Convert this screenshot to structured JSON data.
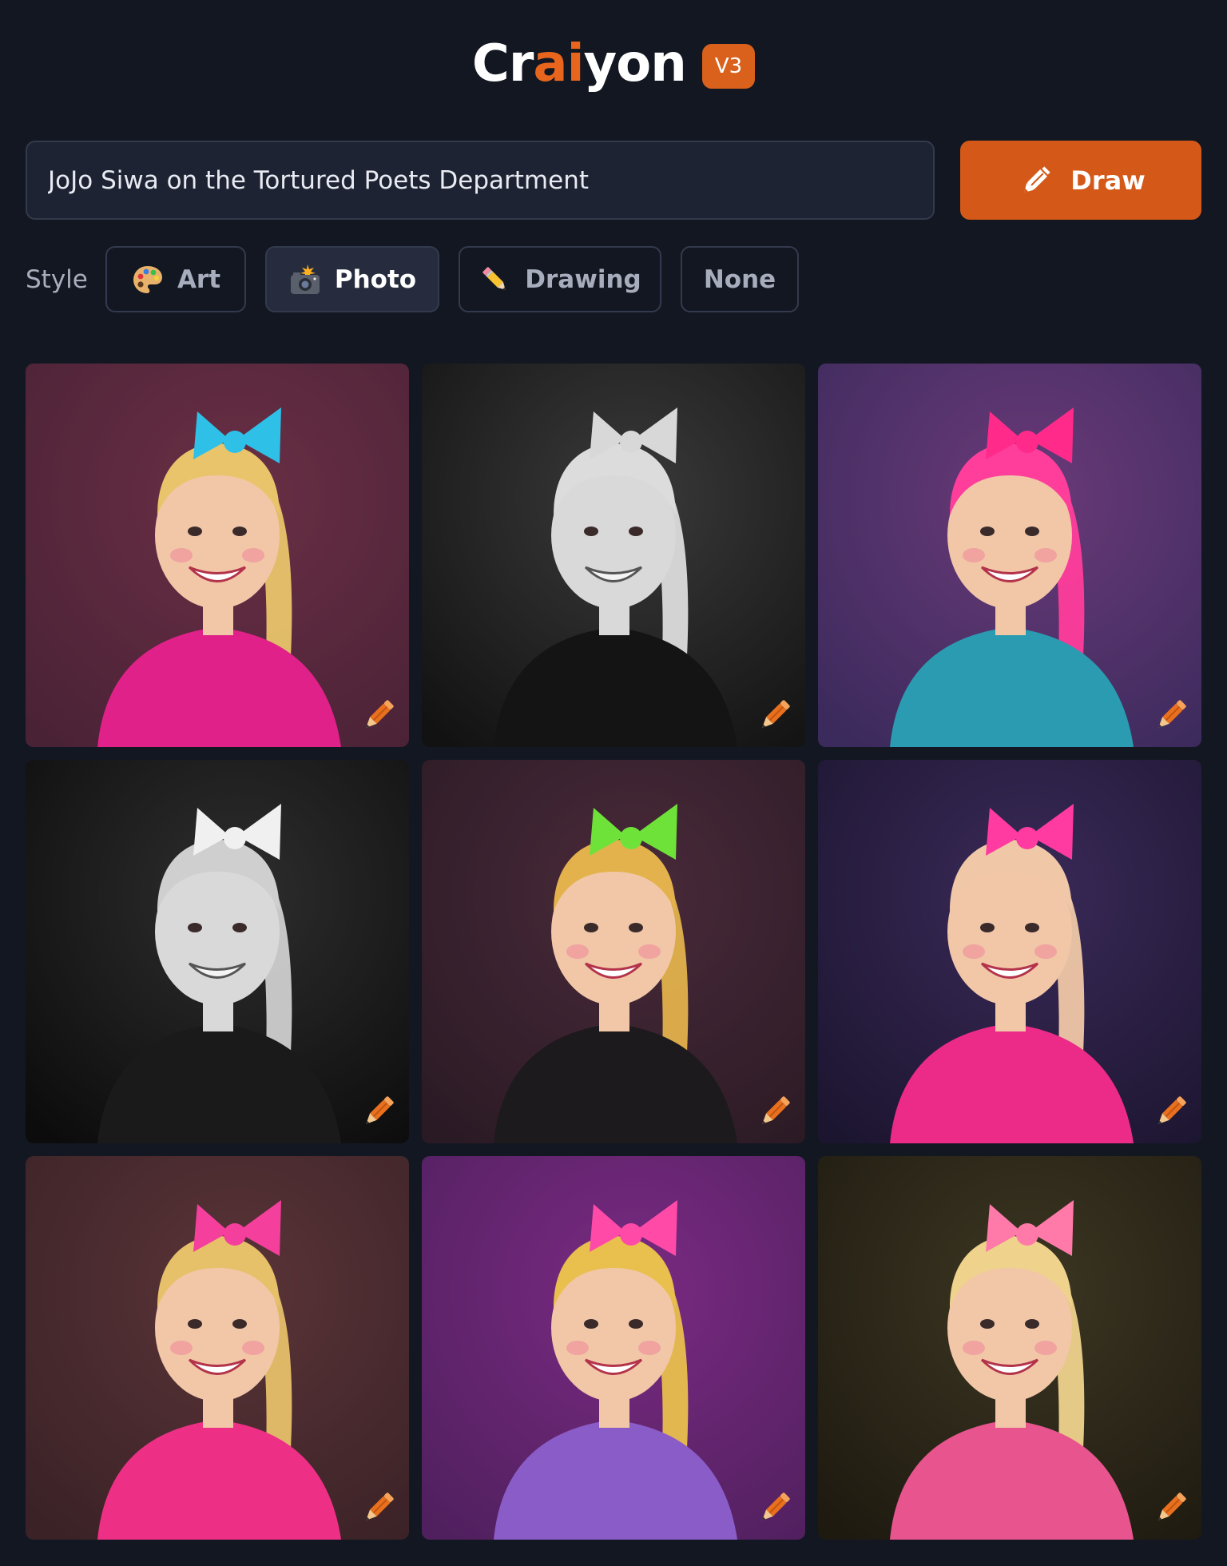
{
  "header": {
    "logo_part1": "Cr",
    "logo_accent": "ai",
    "logo_part2": "yon",
    "version": "V3"
  },
  "prompt": {
    "value": "JoJo Siwa on the Tortured Poets Department",
    "draw_label": "Draw",
    "draw_icon": "pencil-icon"
  },
  "style": {
    "label": "Style",
    "options": [
      {
        "label": "Art",
        "icon": "palette-icon",
        "active": false
      },
      {
        "label": "Photo",
        "icon": "camera-flash-icon",
        "active": true
      },
      {
        "label": "Drawing",
        "icon": "pencil-icon",
        "active": false
      },
      {
        "label": "None",
        "icon": "",
        "active": false
      }
    ]
  },
  "colors": {
    "background": "#131722",
    "accent": "#d45818",
    "input_bg": "#1e2333",
    "border": "#343a4d"
  },
  "results": [
    {
      "id": 1,
      "tone": "color",
      "bg": [
        "#6a2f45",
        "#4a2236"
      ],
      "outfit": "#e0218a",
      "bow": "#2fc0e8",
      "hair": "#e9c46a"
    },
    {
      "id": 2,
      "tone": "bw",
      "bg": [
        "#3a3a3a",
        "#121212"
      ],
      "outfit": "#141414",
      "bow": "#d8d8d8",
      "hair": "#dcdcdc"
    },
    {
      "id": 3,
      "tone": "color",
      "bg": [
        "#6a3a78",
        "#3b2a5c"
      ],
      "outfit": "#2a9bb0",
      "bow": "#ff2a8a",
      "hair": "#ff3d9b"
    },
    {
      "id": 4,
      "tone": "bw",
      "bg": [
        "#2e2e2e",
        "#0c0c0c"
      ],
      "outfit": "#1a1a1a",
      "bow": "#f0f0f0",
      "hair": "#cfcfcf"
    },
    {
      "id": 5,
      "tone": "color",
      "bg": [
        "#4a2a3a",
        "#2a1a24"
      ],
      "outfit": "#1c1a1c",
      "bow": "#6fe23a",
      "hair": "#e3b24c"
    },
    {
      "id": 6,
      "tone": "color",
      "bg": [
        "#3a2a58",
        "#1c1530"
      ],
      "outfit": "#ec2a88",
      "bow": "#ff3aa0",
      "hair": "#f0c8a8"
    },
    {
      "id": 7,
      "tone": "color",
      "bg": [
        "#5a3438",
        "#3a2226"
      ],
      "outfit": "#ee2f86",
      "bow": "#f43f9c",
      "hair": "#e7c06a"
    },
    {
      "id": 8,
      "tone": "color",
      "bg": [
        "#7a2a82",
        "#50205e"
      ],
      "outfit": "#8a5cc8",
      "bow": "#ff4aa8",
      "hair": "#e9bf4e"
    },
    {
      "id": 9,
      "tone": "color",
      "bg": [
        "#3c3622",
        "#1e1a10"
      ],
      "outfit": "#e8558e",
      "bow": "#ff7aa8",
      "hair": "#efd28c"
    }
  ]
}
